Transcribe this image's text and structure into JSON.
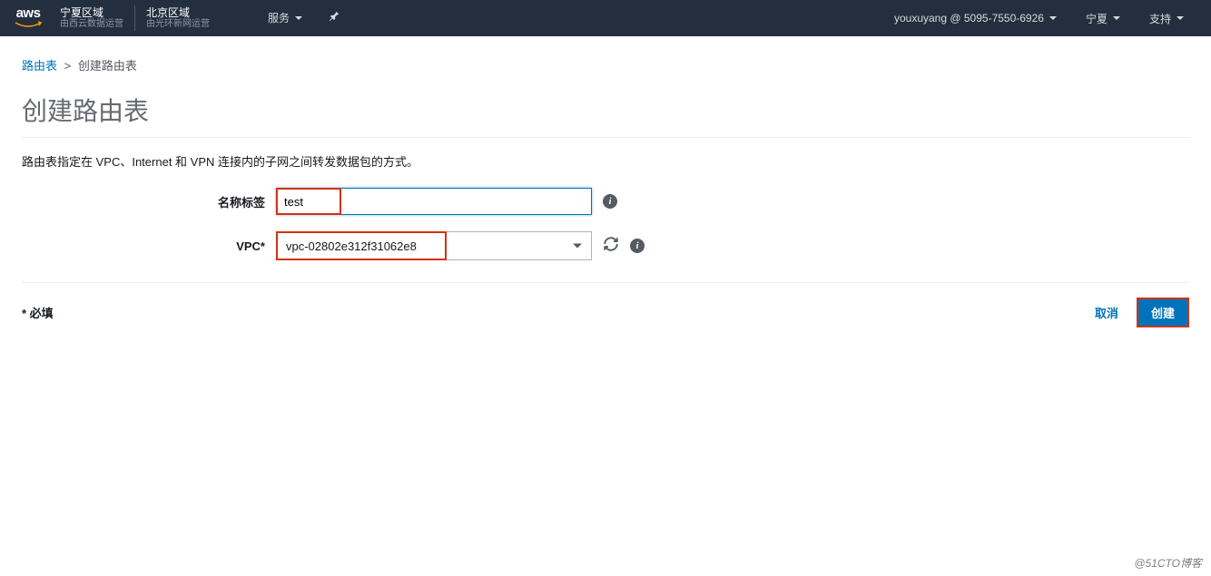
{
  "nav": {
    "logo_text": "aws",
    "region1": {
      "title": "宁夏区域",
      "sub": "由西云数据运营"
    },
    "region2": {
      "title": "北京区域",
      "sub": "由光环新网运营"
    },
    "services_label": "服务",
    "account_label": "youxuyang @ 5095-7550-6926",
    "region_selector_label": "宁夏",
    "support_label": "支持"
  },
  "breadcrumb": {
    "parent": "路由表",
    "separator": ">",
    "current": "创建路由表"
  },
  "page": {
    "title": "创建路由表",
    "description": "路由表指定在 VPC、Internet 和 VPN 连接内的子网之间转发数据包的方式。"
  },
  "form": {
    "name_tag": {
      "label": "名称标签",
      "value": "test"
    },
    "vpc": {
      "label": "VPC*",
      "value": "vpc-02802e312f31062e8"
    }
  },
  "footer": {
    "required_note": "* 必填",
    "cancel_label": "取消",
    "create_label": "创建"
  },
  "watermark": "@51CTO博客"
}
